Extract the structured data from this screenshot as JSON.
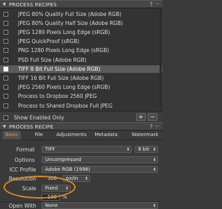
{
  "process_recipes_panel": {
    "title": "PROCESS RECIPES",
    "help_icon": "question-mark",
    "menu_icon": "ellipsis",
    "recipes": [
      {
        "label": "JPEG 80% Quality Full Size (Adobe RGB)",
        "checked": false,
        "selected": false
      },
      {
        "label": "JPEG 80% Quality Half Size (Adobe RGB)",
        "checked": false,
        "selected": false
      },
      {
        "label": "JPEG 1280 Pixels Long Edge (sRGB)",
        "checked": false,
        "selected": false
      },
      {
        "label": "JPEG QuickProof (sRGB)",
        "checked": false,
        "selected": false
      },
      {
        "label": "PNG 1280 Pixels Long Edge (sRGB)",
        "checked": false,
        "selected": false
      },
      {
        "label": "PSD Full Size (Adobe RGB)",
        "checked": false,
        "selected": false
      },
      {
        "label": "TIFF 8 Bit Full Size (Adobe RGB)",
        "checked": true,
        "selected": true
      },
      {
        "label": "TIFF 16 Bit Full Size (Adobe RGB)",
        "checked": false,
        "selected": false
      },
      {
        "label": "JPEG 2560 Pixels Long Edge (sRGB)",
        "checked": false,
        "selected": false
      },
      {
        "label": "Process to Dropbox 2560 JPEG",
        "checked": false,
        "selected": false
      },
      {
        "label": "Process to Shared Dropbox Full JPEG",
        "checked": false,
        "selected": false
      }
    ],
    "show_enabled_only_label": "Show Enabled Only",
    "add_button_label": "+",
    "remove_button_label": "−"
  },
  "process_recipe_panel": {
    "title": "PROCESS RECIPE",
    "tabs": [
      {
        "label": "Basic",
        "active": true
      },
      {
        "label": "File",
        "active": false
      },
      {
        "label": "Adjustments",
        "active": false
      },
      {
        "label": "Metadata",
        "active": false
      },
      {
        "label": "Watermark",
        "active": false
      }
    ],
    "format": {
      "label": "Format",
      "value": "TIFF",
      "bit_depth": "8 bit"
    },
    "options": {
      "label": "Options",
      "value": "Uncompressed"
    },
    "icc_profile": {
      "label": "ICC Profile",
      "value": "Adobe RGB (1998)"
    },
    "resolution": {
      "label": "Resolution",
      "value": "300",
      "unit": "px/in"
    },
    "scale": {
      "label": "Scale",
      "value": "Fixed",
      "percent": "100",
      "percent_unit": "%"
    },
    "open_with": {
      "label": "Open With",
      "value": "None"
    }
  },
  "colors": {
    "accent": "#ff8a3d",
    "highlight_oval": "#e58a1c",
    "selected_row": "#5b5b5b"
  }
}
